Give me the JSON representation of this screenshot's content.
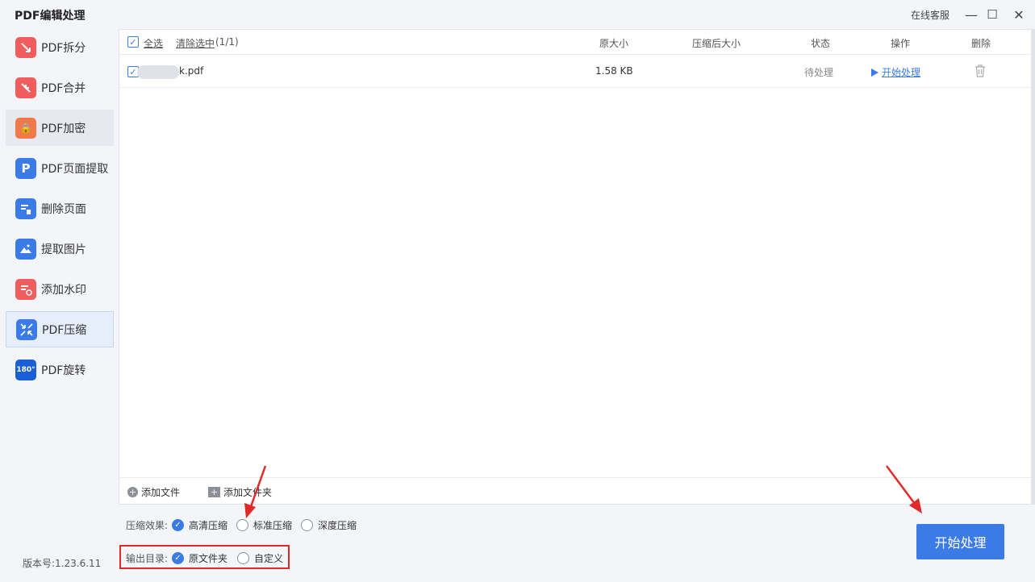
{
  "window": {
    "title": "PDF编辑处理",
    "support": "在线客服",
    "minimize": "—",
    "maximize": "☐",
    "close": "✕"
  },
  "sidebar": {
    "items": [
      {
        "label": "PDF拆分",
        "icon": "split-icon",
        "color": "#ef5d5d"
      },
      {
        "label": "PDF合并",
        "icon": "merge-icon",
        "color": "#ef5d5d"
      },
      {
        "label": "PDF加密",
        "icon": "lock-icon",
        "color": "#f07a4a"
      },
      {
        "label": "PDF页面提取",
        "icon": "page-extract-icon",
        "color": "#3b7be8"
      },
      {
        "label": "删除页面",
        "icon": "delete-page-icon",
        "color": "#3b7be8"
      },
      {
        "label": "提取图片",
        "icon": "image-extract-icon",
        "color": "#3b7be8"
      },
      {
        "label": "添加水印",
        "icon": "watermark-icon",
        "color": "#ef5d5d"
      },
      {
        "label": "PDF压缩",
        "icon": "compress-icon",
        "color": "#3b7be8"
      },
      {
        "label": "PDF旋转",
        "icon": "rotate-icon",
        "color": "#1a5fd6"
      }
    ],
    "active_index": 7,
    "icon_glyphs": {
      "lock": "🔒",
      "page": "P",
      "rotate": "180°"
    }
  },
  "version": "版本号:1.23.6.11",
  "table": {
    "select_all": "全选",
    "clear_selection": "清除选中",
    "selection_count": "(1/1)",
    "headers": {
      "original_size": "原大小",
      "compressed_size": "压缩后大小",
      "status": "状态",
      "action": "操作",
      "delete": "删除"
    },
    "rows": [
      {
        "filename": "k.pdf",
        "original_size": "1.58 KB",
        "compressed_size": "",
        "status": "待处理",
        "action": "开始处理"
      }
    ],
    "add_file": "添加文件",
    "add_folder": "添加文件夹"
  },
  "options": {
    "effect_label": "压缩效果:",
    "effect_choices": [
      "高清压缩",
      "标准压缩",
      "深度压缩"
    ],
    "effect_selected": 0,
    "output_label": "输出目录:",
    "output_choices": [
      "原文件夹",
      "自定义"
    ],
    "output_selected": 0
  },
  "start_button": "开始处理",
  "colors": {
    "accent": "#3b7be8",
    "annotation": "#e02a2a"
  }
}
